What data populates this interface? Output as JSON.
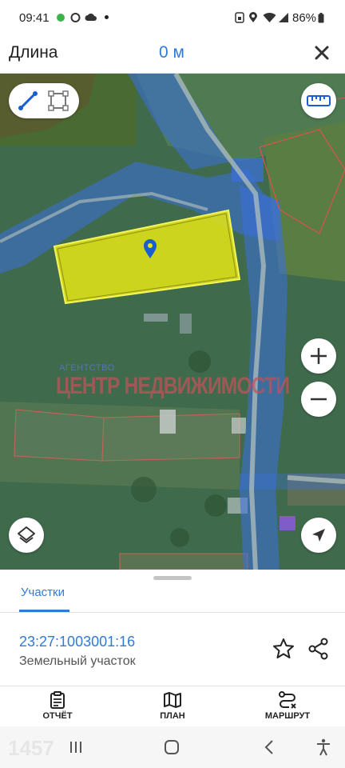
{
  "status_bar": {
    "time": "09:41",
    "battery": "86%",
    "icons": [
      "whatsapp-icon",
      "chat-icon",
      "cloud-icon",
      "sim-icon",
      "location-icon",
      "wifi-icon",
      "signal-icon",
      "battery-icon"
    ]
  },
  "header": {
    "title": "Длина",
    "value": "0 м",
    "close_icon": "close-icon"
  },
  "map": {
    "watermark_top": "АГЕНТСТВО",
    "watermark_main": "ЦЕНТР НЕДВИЖИМОСТИ",
    "controls": {
      "line_tool": "polyline-icon",
      "area_tool": "polygon-icon",
      "ruler": "ruler-icon",
      "zoom_in": "plus-icon",
      "zoom_out": "minus-icon",
      "layers": "layers-icon",
      "locate": "navigation-arrow-icon"
    },
    "colors": {
      "highlight": "#e6e615",
      "zone_blue": "#3a6fe0",
      "boundary_red": "#d9534f"
    }
  },
  "sheet": {
    "tab_label": "Участки",
    "parcel_id": "23:27:1003001:16",
    "parcel_type": "Земельный участок"
  },
  "bottom_nav": {
    "report": "ОТЧЁТ",
    "plan": "ПЛАН",
    "route": "МАРШРУТ"
  },
  "system_nav": {
    "badge": "1457"
  },
  "accent_color": "#2f7bd8"
}
